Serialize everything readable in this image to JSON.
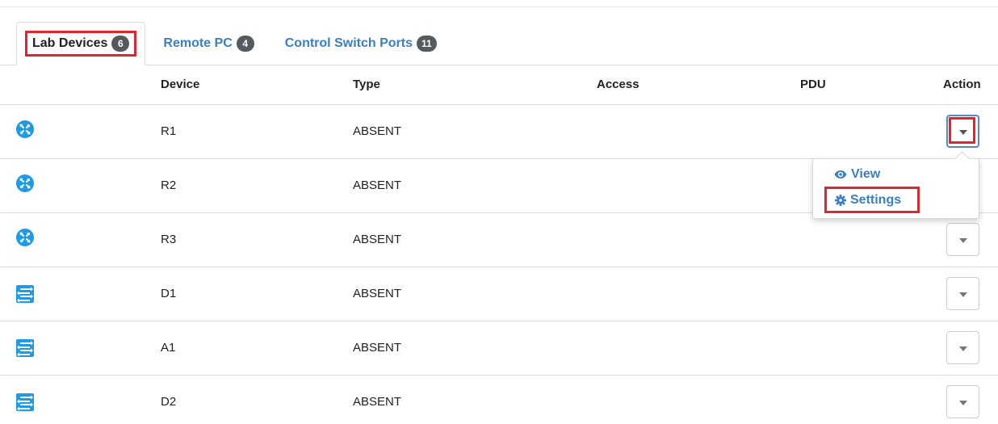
{
  "tabs": [
    {
      "label": "Lab Devices",
      "count": "6"
    },
    {
      "label": "Remote PC",
      "count": "4"
    },
    {
      "label": "Control Switch Ports",
      "count": "11"
    }
  ],
  "table": {
    "headers": {
      "device": "Device",
      "type": "Type",
      "access": "Access",
      "pdu": "PDU",
      "action": "Action"
    },
    "rows": [
      {
        "icon": "router-icon",
        "device": "R1",
        "type": "ABSENT"
      },
      {
        "icon": "router-icon",
        "device": "R2",
        "type": "ABSENT"
      },
      {
        "icon": "router-icon",
        "device": "R3",
        "type": "ABSENT"
      },
      {
        "icon": "switch-icon",
        "device": "D1",
        "type": "ABSENT"
      },
      {
        "icon": "switch-icon",
        "device": "A1",
        "type": "ABSENT"
      },
      {
        "icon": "switch-icon",
        "device": "D2",
        "type": "ABSENT"
      }
    ]
  },
  "menu": {
    "items": [
      {
        "label": "View",
        "icon": "eye-icon"
      },
      {
        "label": "Settings",
        "icon": "gear-icon"
      }
    ]
  },
  "colors": {
    "accent": "#3a7fc1",
    "icon_blue": "#1e9be8",
    "highlight": "#e0252f",
    "badge": "#555a5f"
  }
}
